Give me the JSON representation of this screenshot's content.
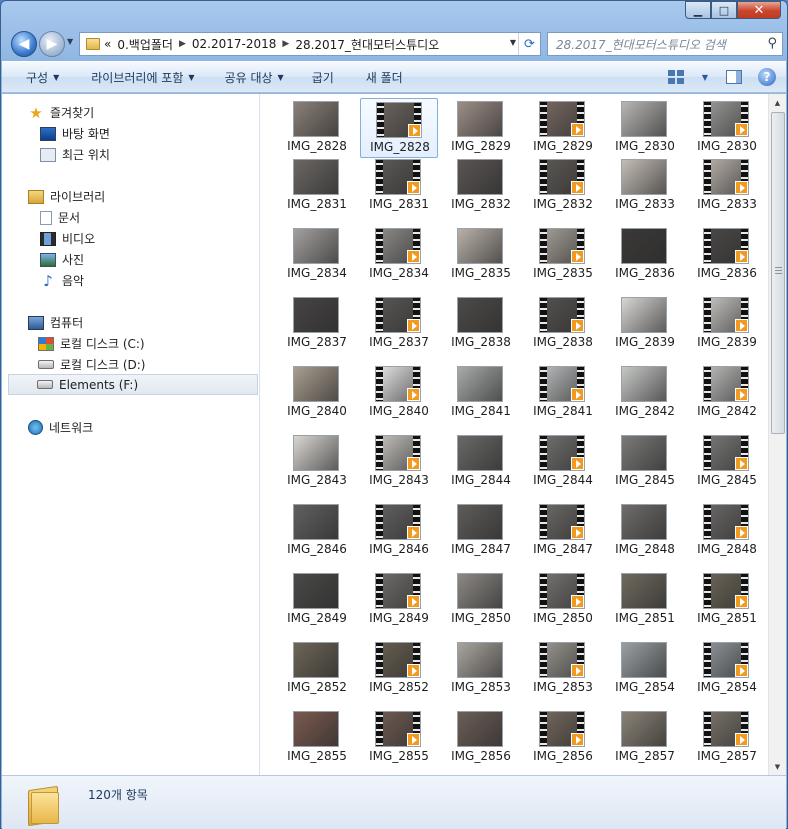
{
  "window": {
    "caption": {
      "minimize": "▁",
      "maximize": "□",
      "close": "✕"
    }
  },
  "address_bar": {
    "overflow": "«",
    "crumbs": [
      "0.백업폴더",
      "02.2017-2018",
      "28.2017_현대모터스튜디오"
    ],
    "separator": "▶"
  },
  "search": {
    "placeholder": "28.2017_현대모터스튜디오 검색",
    "icon": "search-icon"
  },
  "toolbar": {
    "organize": "구성",
    "include_in_library": "라이브러리에 포함",
    "share_with": "공유 대상",
    "burn": "굽기",
    "new_folder": "새 폴더",
    "help": "?"
  },
  "nav_pane": {
    "favorites": "즐겨찾기",
    "desktop": "바탕 화면",
    "recent": "최근 위치",
    "libraries": "라이브러리",
    "documents": "문서",
    "videos": "비디오",
    "pictures": "사진",
    "music": "음악",
    "computer": "컴퓨터",
    "drive_c": "로컬 디스크 (C:)",
    "drive_d": "로컬 디스크 (D:)",
    "drive_f": "Elements (F:)",
    "network": "네트워크"
  },
  "files": [
    {
      "name": "IMG_2828",
      "type": "image",
      "tone": "#8a8078"
    },
    {
      "name": "IMG_2828",
      "type": "video",
      "tone": "#6d6660",
      "selected": true
    },
    {
      "name": "IMG_2829",
      "type": "image",
      "tone": "#9c8e86"
    },
    {
      "name": "IMG_2829",
      "type": "video",
      "tone": "#7a6a62"
    },
    {
      "name": "IMG_2830",
      "type": "image",
      "tone": "#b7b6b4"
    },
    {
      "name": "IMG_2830",
      "type": "video",
      "tone": "#9a9a98"
    },
    {
      "name": "IMG_2831",
      "type": "image",
      "tone": "#6b6764"
    },
    {
      "name": "IMG_2831",
      "type": "video",
      "tone": "#5d5a57"
    },
    {
      "name": "IMG_2832",
      "type": "image",
      "tone": "#5a5553"
    },
    {
      "name": "IMG_2832",
      "type": "video",
      "tone": "#5e5955"
    },
    {
      "name": "IMG_2833",
      "type": "image",
      "tone": "#c4bdb5"
    },
    {
      "name": "IMG_2833",
      "type": "video",
      "tone": "#b8b1aa"
    },
    {
      "name": "IMG_2834",
      "type": "image",
      "tone": "#a3a09e"
    },
    {
      "name": "IMG_2834",
      "type": "video",
      "tone": "#8f8d8a"
    },
    {
      "name": "IMG_2835",
      "type": "image",
      "tone": "#b9b0a8"
    },
    {
      "name": "IMG_2835",
      "type": "video",
      "tone": "#a8a199"
    },
    {
      "name": "IMG_2836",
      "type": "image",
      "tone": "#3b3938"
    },
    {
      "name": "IMG_2836",
      "type": "video",
      "tone": "#4b4947"
    },
    {
      "name": "IMG_2837",
      "type": "image",
      "tone": "#474544"
    },
    {
      "name": "IMG_2837",
      "type": "video",
      "tone": "#5a5856"
    },
    {
      "name": "IMG_2838",
      "type": "image",
      "tone": "#4d4b49"
    },
    {
      "name": "IMG_2838",
      "type": "video",
      "tone": "#55524f"
    },
    {
      "name": "IMG_2839",
      "type": "image",
      "tone": "#d8d6d3"
    },
    {
      "name": "IMG_2839",
      "type": "video",
      "tone": "#c9c6c2"
    },
    {
      "name": "IMG_2840",
      "type": "image",
      "tone": "#a99e8f"
    },
    {
      "name": "IMG_2840",
      "type": "video",
      "tone": "#e9e9e9"
    },
    {
      "name": "IMG_2841",
      "type": "image",
      "tone": "#a7aaa9"
    },
    {
      "name": "IMG_2841",
      "type": "video",
      "tone": "#b9bdbd"
    },
    {
      "name": "IMG_2842",
      "type": "image",
      "tone": "#c6c8c6"
    },
    {
      "name": "IMG_2842",
      "type": "video",
      "tone": "#bcbcbb"
    },
    {
      "name": "IMG_2843",
      "type": "image",
      "tone": "#d9d6d2"
    },
    {
      "name": "IMG_2843",
      "type": "video",
      "tone": "#c7c4bf"
    },
    {
      "name": "IMG_2844",
      "type": "image",
      "tone": "#6a6968"
    },
    {
      "name": "IMG_2844",
      "type": "video",
      "tone": "#727170"
    },
    {
      "name": "IMG_2845",
      "type": "image",
      "tone": "#7b7a79"
    },
    {
      "name": "IMG_2845",
      "type": "video",
      "tone": "#7a7978"
    },
    {
      "name": "IMG_2846",
      "type": "image",
      "tone": "#606060"
    },
    {
      "name": "IMG_2846",
      "type": "video",
      "tone": "#636262"
    },
    {
      "name": "IMG_2847",
      "type": "image",
      "tone": "#5f5c59"
    },
    {
      "name": "IMG_2847",
      "type": "video",
      "tone": "#6d6a66"
    },
    {
      "name": "IMG_2848",
      "type": "image",
      "tone": "#6f6c6a"
    },
    {
      "name": "IMG_2848",
      "type": "video",
      "tone": "#6b6967"
    },
    {
      "name": "IMG_2849",
      "type": "image",
      "tone": "#4a4948"
    },
    {
      "name": "IMG_2849",
      "type": "video",
      "tone": "#6f6e6c"
    },
    {
      "name": "IMG_2850",
      "type": "image",
      "tone": "#8c8884"
    },
    {
      "name": "IMG_2850",
      "type": "video",
      "tone": "#777471"
    },
    {
      "name": "IMG_2851",
      "type": "image",
      "tone": "#6f6a5e"
    },
    {
      "name": "IMG_2851",
      "type": "video",
      "tone": "#6c6658"
    },
    {
      "name": "IMG_2852",
      "type": "image",
      "tone": "#6d6557"
    },
    {
      "name": "IMG_2852",
      "type": "video",
      "tone": "#685f51"
    },
    {
      "name": "IMG_2853",
      "type": "image",
      "tone": "#a9a49e"
    },
    {
      "name": "IMG_2853",
      "type": "video",
      "tone": "#9c9892"
    },
    {
      "name": "IMG_2854",
      "type": "image",
      "tone": "#99a0a4"
    },
    {
      "name": "IMG_2854",
      "type": "video",
      "tone": "#8e9599"
    },
    {
      "name": "IMG_2855",
      "type": "image",
      "tone": "#7a5a4f"
    },
    {
      "name": "IMG_2855",
      "type": "video",
      "tone": "#6f5c52"
    },
    {
      "name": "IMG_2856",
      "type": "image",
      "tone": "#6b5e56"
    },
    {
      "name": "IMG_2856",
      "type": "video",
      "tone": "#76685e"
    },
    {
      "name": "IMG_2857",
      "type": "image",
      "tone": "#8a8276"
    },
    {
      "name": "IMG_2857",
      "type": "video",
      "tone": "#7b746a"
    }
  ],
  "status_bar": {
    "count_text": "120개 항목"
  },
  "colors": {
    "play_badge": "#f29a1f",
    "selection": "#85aee0"
  }
}
